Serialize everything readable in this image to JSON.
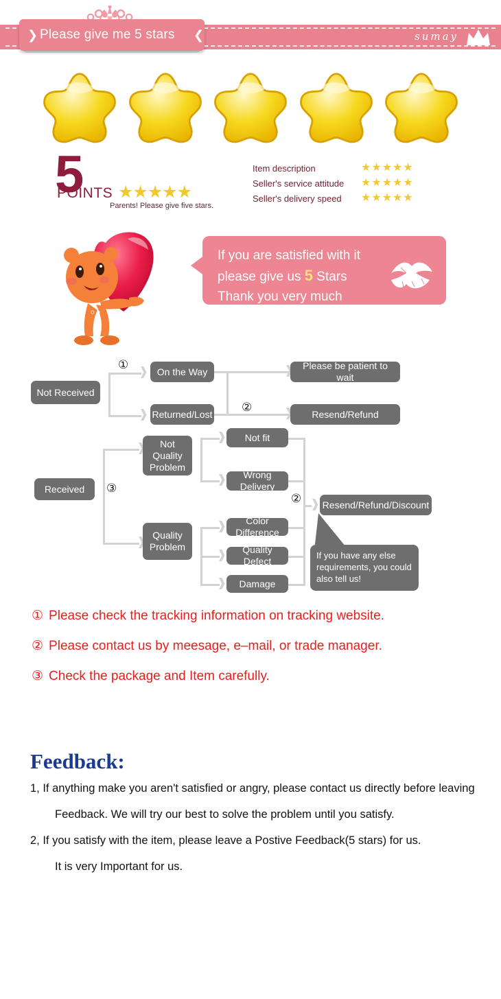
{
  "banner": {
    "title": "Please give me 5 stars",
    "brand": "sumay",
    "ribbon_left": "❯",
    "ribbon_right": "❮",
    "pink": "#e8828e"
  },
  "hero_stars": {
    "count": 5,
    "icon": "star-icon",
    "color": "#f5d020"
  },
  "points": {
    "number": "5",
    "word": "POINTS",
    "stars": "★★★★★",
    "note": "Parents! Please give five stars.",
    "color": "#8e1c3c"
  },
  "ratings": {
    "rows": [
      {
        "label": "Item description",
        "stars": "★★★★★"
      },
      {
        "label": "Seller's service attitude",
        "stars": "★★★★★"
      },
      {
        "label": "Seller's delivery speed",
        "stars": "★★★★★"
      }
    ],
    "star_color": "#f0c83a"
  },
  "bubble": {
    "line1": "If you are satisfied with it",
    "line2a": "please give us ",
    "line2_num": "5",
    "line2b": " Stars",
    "line3": "Thank you very much",
    "bg": "#ee8593"
  },
  "flow": {
    "boxes": [
      {
        "id": "not-received",
        "label": "Not Received"
      },
      {
        "id": "on-the-way",
        "label": "On the Way"
      },
      {
        "id": "returned-lost",
        "label": "Returned/Lost"
      },
      {
        "id": "please-be-patient",
        "label": "Please be patient to wait"
      },
      {
        "id": "resend-refund",
        "label": "Resend/Refund"
      },
      {
        "id": "received",
        "label": "Received"
      },
      {
        "id": "not-quality-problem",
        "label": "Not Quality Problem"
      },
      {
        "id": "quality-problem",
        "label": "Quality Problem"
      },
      {
        "id": "not-fit",
        "label": "Not fit"
      },
      {
        "id": "wrong-delivery",
        "label": "Wrong Delivery"
      },
      {
        "id": "color-difference",
        "label": "Color Difference"
      },
      {
        "id": "quality-defect",
        "label": "Quality Defect"
      },
      {
        "id": "damage",
        "label": "Damage"
      },
      {
        "id": "resend-refund-discount",
        "label": "Resend/Refund/Discount"
      }
    ],
    "markers": {
      "m1": "①",
      "m2a": "②",
      "m2b": "②",
      "m3": "③"
    },
    "callout": "If you have any else requirements, you could also tell us!",
    "box_color": "#6e6e6e",
    "line_color": "#d2d2d2"
  },
  "notes": [
    {
      "num": "①",
      "text": "Please check the tracking information on tracking website."
    },
    {
      "num": "②",
      "text": "Please contact us by meesage, e–mail, or trade manager."
    },
    {
      "num": "③",
      "text": "Check the package and Item carefully."
    }
  ],
  "notes_color": "#ed1c1c",
  "feedback": {
    "title": "Feedback:",
    "title_color": "#1a3a8f",
    "lines": [
      "1, If anything make you aren't satisfied or angry, please contact us directly before leaving",
      "Feedback. We will try our best to solve the problem until you satisfy.",
      "2, If you satisfy with the item, please leave a Postive Feedback(5 stars) for us.",
      "It is very Important for us."
    ]
  }
}
